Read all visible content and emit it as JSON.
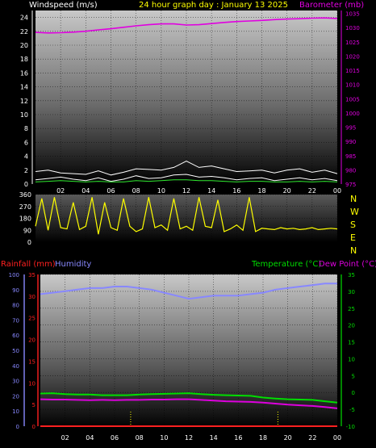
{
  "header": {
    "wind_title": "Windspeed (m/s)",
    "graph_title": "24 hour graph day : January 13 2025",
    "baro_title": "Barometer (mb)"
  },
  "colors": {
    "windspeed": "#ffffff",
    "gust": "#ffffff",
    "wind_avg": "#2ee82e",
    "barometer": "#e000e0",
    "direction": "#ffff00",
    "humidity": "#8888ff",
    "temperature": "#00dd00",
    "dewpoint": "#dd00dd",
    "rainfall": "#ff2020",
    "title": "#ffff00"
  },
  "compass_labels": [
    "N",
    "W",
    "S",
    "E",
    "N"
  ],
  "bottom_header": {
    "rain_title": "Rainfall (mm)",
    "humidity_title": "Humidity",
    "temp_title": "Temperature (°C)",
    "dew_title": "Dew Point (°C)"
  },
  "chart_data": [
    {
      "type": "line",
      "panel": "wind_barometer",
      "x_ticks": [
        "02",
        "04",
        "06",
        "08",
        "10",
        "12",
        "14",
        "16",
        "18",
        "20",
        "22",
        "00"
      ],
      "xlim": [
        0,
        24
      ],
      "left_axis": {
        "title": "Windspeed (m/s)",
        "ticks": [
          0,
          2,
          4,
          6,
          8,
          10,
          12,
          14,
          16,
          18,
          20,
          22,
          24
        ],
        "ylim": [
          0,
          25
        ]
      },
      "right_axis": {
        "title": "Barometer (mb)",
        "ticks": [
          975,
          980,
          985,
          990,
          995,
          1000,
          1005,
          1010,
          1015,
          1020,
          1025,
          1030,
          1035
        ],
        "ylim": [
          975,
          1036
        ]
      },
      "grid": true,
      "series": [
        {
          "name": "Barometer (mb)",
          "axis": "right",
          "x": [
            0,
            1,
            2,
            3,
            4,
            5,
            6,
            7,
            8,
            9,
            10,
            11,
            12,
            13,
            14,
            15,
            16,
            17,
            18,
            19,
            20,
            21,
            22,
            23,
            24
          ],
          "values": [
            1028.3,
            1028.1,
            1028.2,
            1028.4,
            1028.7,
            1029.2,
            1029.6,
            1030.1,
            1030.6,
            1031.0,
            1031.3,
            1031.3,
            1030.9,
            1031.0,
            1031.4,
            1031.8,
            1032.1,
            1032.3,
            1032.5,
            1032.8,
            1033.0,
            1033.1,
            1033.3,
            1033.4,
            1033.2
          ]
        },
        {
          "name": "Windspeed",
          "axis": "left",
          "x": [
            0,
            1,
            2,
            3,
            4,
            5,
            6,
            7,
            8,
            9,
            10,
            11,
            12,
            13,
            14,
            15,
            16,
            17,
            18,
            19,
            20,
            21,
            22,
            23,
            24
          ],
          "values": [
            0.6,
            0.8,
            1.0,
            0.7,
            0.5,
            0.9,
            0.4,
            0.7,
            1.2,
            0.8,
            0.9,
            1.3,
            1.4,
            1.0,
            1.1,
            0.9,
            0.6,
            0.8,
            0.9,
            0.5,
            0.7,
            0.9,
            0.6,
            0.8,
            0.5
          ]
        },
        {
          "name": "Gust",
          "axis": "left",
          "x": [
            0,
            1,
            2,
            3,
            4,
            5,
            6,
            7,
            8,
            9,
            10,
            11,
            12,
            13,
            14,
            15,
            16,
            17,
            18,
            19,
            20,
            21,
            22,
            23,
            24
          ],
          "values": [
            1.8,
            2.0,
            1.6,
            1.5,
            1.4,
            1.9,
            1.3,
            1.7,
            2.2,
            2.1,
            2.0,
            2.4,
            3.3,
            2.4,
            2.6,
            2.2,
            1.8,
            1.9,
            2.0,
            1.6,
            2.0,
            2.2,
            1.7,
            2.0,
            1.5
          ]
        },
        {
          "name": "Average",
          "axis": "left",
          "x": [
            0,
            1,
            2,
            3,
            4,
            5,
            6,
            7,
            8,
            9,
            10,
            11,
            12,
            13,
            14,
            15,
            16,
            17,
            18,
            19,
            20,
            21,
            22,
            23,
            24
          ],
          "values": [
            0.3,
            0.4,
            0.5,
            0.4,
            0.3,
            0.4,
            0.3,
            0.3,
            0.5,
            0.4,
            0.5,
            0.6,
            0.6,
            0.5,
            0.5,
            0.4,
            0.3,
            0.4,
            0.4,
            0.3,
            0.3,
            0.4,
            0.3,
            0.4,
            0.3
          ]
        }
      ]
    },
    {
      "type": "line",
      "panel": "wind_direction",
      "x_ticks": [
        "02",
        "04",
        "06",
        "08",
        "10",
        "12",
        "14",
        "16",
        "18",
        "20",
        "22",
        "00"
      ],
      "xlim": [
        0,
        24
      ],
      "left_axis": {
        "ticks": [
          0,
          90,
          180,
          270,
          360
        ],
        "ylim": [
          0,
          360
        ]
      },
      "right_axis_labels": [
        "N",
        "W",
        "S",
        "E",
        "N"
      ],
      "grid": true,
      "series": [
        {
          "name": "Wind direction",
          "x": [
            0,
            0.5,
            1,
            1.5,
            2,
            2.5,
            3,
            3.5,
            4,
            4.5,
            5,
            5.5,
            6,
            6.5,
            7,
            7.5,
            8,
            8.5,
            9,
            9.5,
            10,
            10.5,
            11,
            11.5,
            12,
            12.5,
            13,
            13.5,
            14,
            14.5,
            15,
            15.5,
            16,
            16.5,
            17,
            17.5,
            18,
            18.5,
            19,
            19.5,
            20,
            20.5,
            21,
            21.5,
            22,
            22.5,
            23,
            23.5,
            24
          ],
          "values": [
            120,
            330,
            90,
            340,
            110,
            100,
            300,
            95,
            120,
            340,
            60,
            300,
            110,
            90,
            330,
            120,
            80,
            100,
            340,
            110,
            130,
            90,
            330,
            100,
            120,
            90,
            340,
            120,
            110,
            320,
            80,
            100,
            130,
            90,
            340,
            80,
            105,
            100,
            95,
            110,
            100,
            105,
            95,
            100,
            110,
            95,
            100,
            105,
            100
          ]
        }
      ]
    },
    {
      "type": "line",
      "panel": "temp_humidity_rain",
      "x_ticks": [
        "02",
        "04",
        "06",
        "08",
        "10",
        "12",
        "14",
        "16",
        "18",
        "20",
        "22",
        "00"
      ],
      "xlim": [
        0,
        24
      ],
      "rain_axis": {
        "title": "Rainfall (mm)",
        "ticks": [
          0,
          5,
          10,
          15,
          20,
          25,
          30,
          35
        ],
        "ylim": [
          0,
          35
        ]
      },
      "humidity_axis": {
        "title": "Humidity",
        "ticks": [
          0,
          10,
          20,
          30,
          40,
          50,
          60,
          70,
          80,
          90,
          100
        ],
        "ylim": [
          0,
          100
        ]
      },
      "temperature_axis": {
        "title": "Temperature (°C)",
        "ticks": [
          -10,
          -5,
          0,
          5,
          10,
          15,
          20,
          25,
          30,
          35
        ],
        "ylim": [
          -10,
          35
        ]
      },
      "grid": true,
      "series": [
        {
          "name": "Humidity",
          "axis": "humidity",
          "x": [
            0,
            1,
            2,
            3,
            4,
            5,
            6,
            7,
            8,
            9,
            10,
            11,
            12,
            13,
            14,
            15,
            16,
            17,
            18,
            19,
            20,
            21,
            22,
            23,
            24
          ],
          "values": [
            87,
            88,
            89,
            90,
            91,
            91,
            92,
            92,
            91,
            90,
            88,
            86,
            84,
            85,
            86,
            86,
            86,
            87,
            88,
            90,
            91,
            92,
            93,
            94,
            94
          ]
        },
        {
          "name": "Temperature (°C)",
          "axis": "temperature",
          "x": [
            0,
            1,
            2,
            3,
            4,
            5,
            6,
            7,
            8,
            9,
            10,
            11,
            12,
            13,
            14,
            15,
            16,
            17,
            18,
            19,
            20,
            21,
            22,
            23,
            24
          ],
          "values": [
            -0.3,
            -0.2,
            -0.5,
            -0.6,
            -0.6,
            -0.8,
            -0.8,
            -0.8,
            -0.6,
            -0.5,
            -0.4,
            -0.3,
            -0.2,
            -0.5,
            -0.7,
            -0.8,
            -0.9,
            -1.0,
            -1.5,
            -1.8,
            -2.0,
            -2.1,
            -2.2,
            -2.6,
            -3.0
          ]
        },
        {
          "name": "Dew Point (°C)",
          "axis": "temperature",
          "x": [
            0,
            1,
            2,
            3,
            4,
            5,
            6,
            7,
            8,
            9,
            10,
            11,
            12,
            13,
            14,
            15,
            16,
            17,
            18,
            19,
            20,
            21,
            22,
            23,
            24
          ],
          "values": [
            -2.0,
            -2.1,
            -2.1,
            -2.2,
            -2.3,
            -2.2,
            -2.3,
            -2.2,
            -2.2,
            -2.1,
            -2.1,
            -2.0,
            -2.0,
            -2.2,
            -2.4,
            -2.6,
            -2.7,
            -2.8,
            -3.0,
            -3.3,
            -3.6,
            -3.8,
            -4.0,
            -4.3,
            -4.7
          ]
        },
        {
          "name": "Rainfall (mm)",
          "axis": "rain",
          "x": [
            0,
            24
          ],
          "values": [
            0,
            0
          ]
        }
      ],
      "markers": [
        7.3,
        19.2
      ]
    }
  ]
}
